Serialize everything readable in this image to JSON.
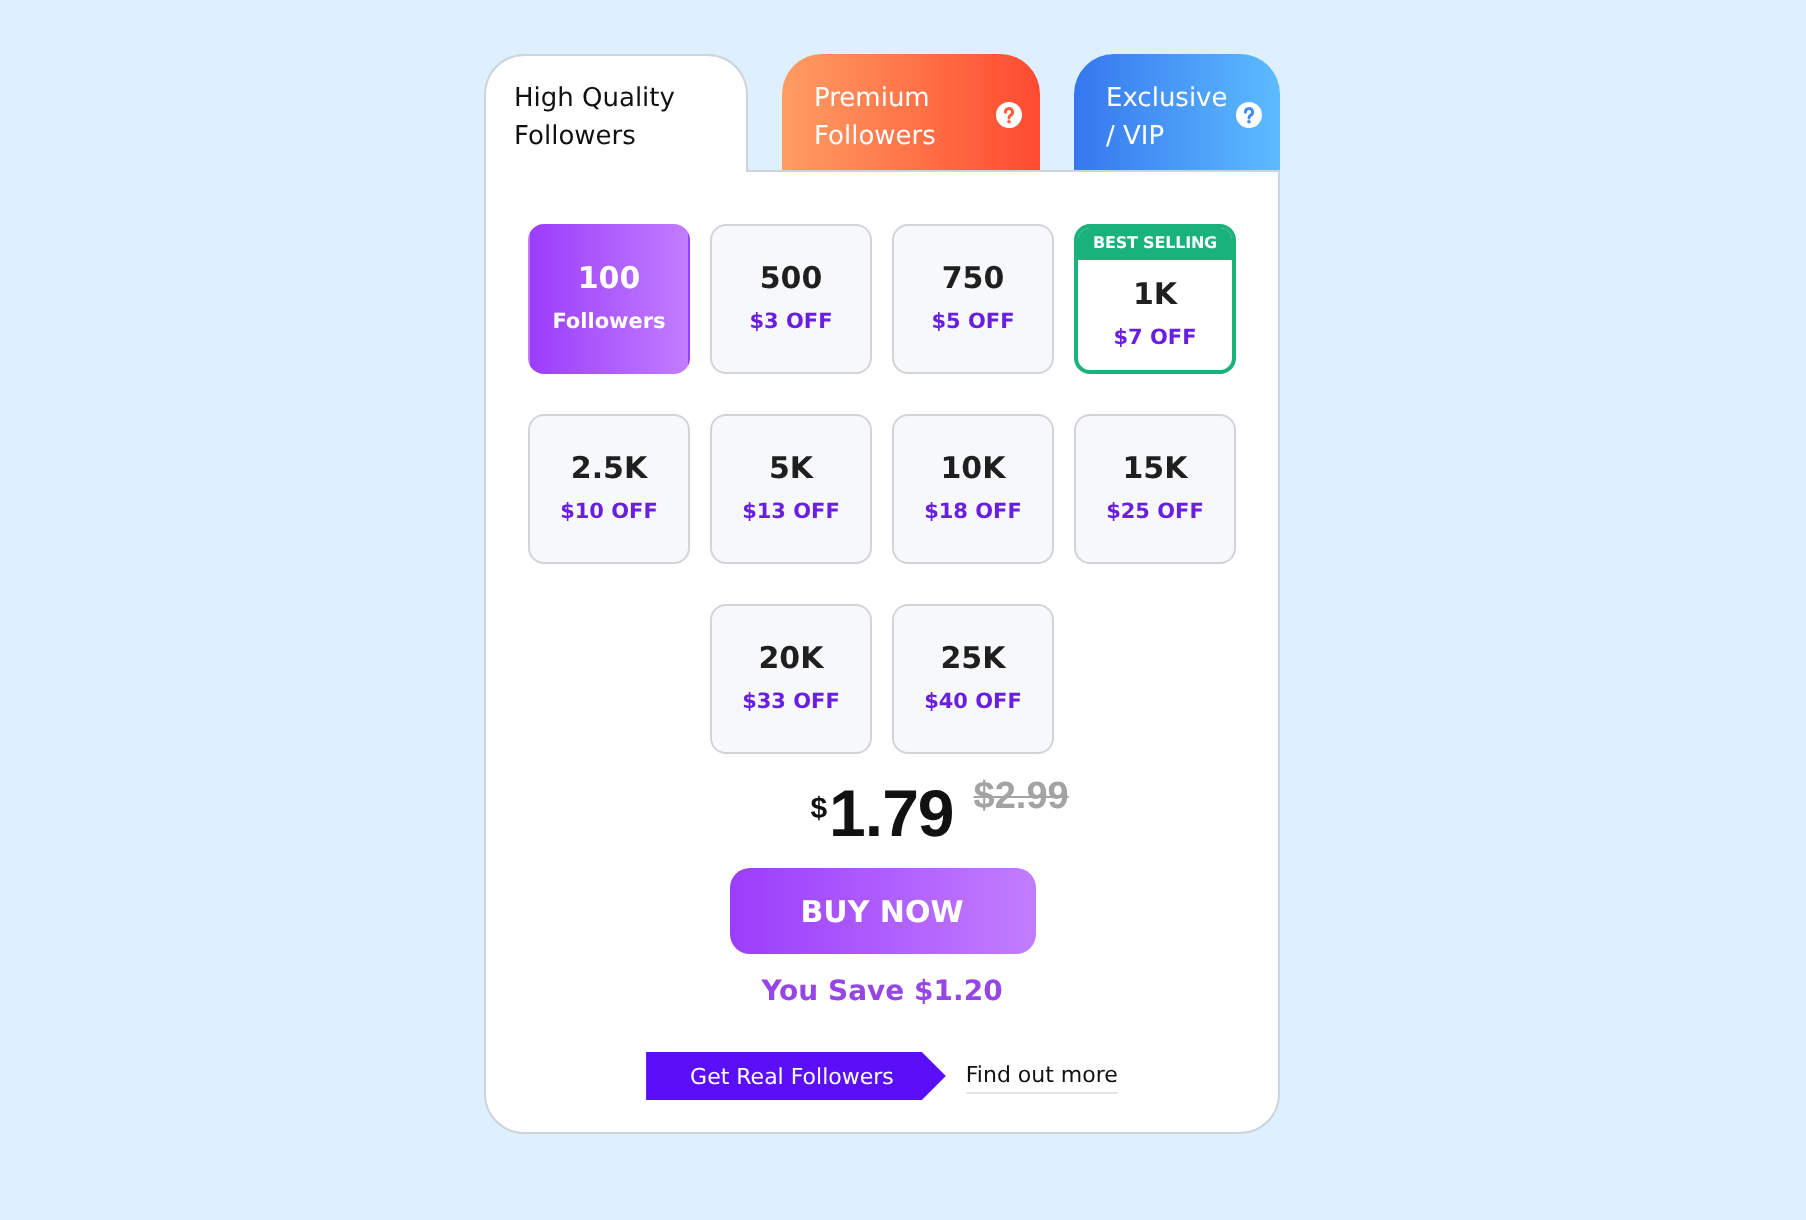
{
  "tabs": [
    {
      "label": "High Quality Followers",
      "kind": "standard",
      "selected": true,
      "help_icon": false
    },
    {
      "label": "Premium Followers",
      "kind": "premium",
      "selected": false,
      "help_icon": true
    },
    {
      "label": "Exclusive / VIP",
      "kind": "vip",
      "selected": false,
      "help_icon": true
    }
  ],
  "packages": [
    {
      "quantity": "100",
      "detail": "Followers",
      "selected": true
    },
    {
      "quantity": "500",
      "detail": "$3 OFF",
      "selected": false
    },
    {
      "quantity": "750",
      "detail": "$5 OFF",
      "selected": false
    },
    {
      "quantity": "1K",
      "detail": "$7 OFF",
      "selected": false,
      "badge": "BEST SELLING"
    },
    {
      "quantity": "2.5K",
      "detail": "$10 OFF",
      "selected": false
    },
    {
      "quantity": "5K",
      "detail": "$13 OFF",
      "selected": false
    },
    {
      "quantity": "10K",
      "detail": "$18 OFF",
      "selected": false
    },
    {
      "quantity": "15K",
      "detail": "$25 OFF",
      "selected": false
    },
    {
      "quantity": "20K",
      "detail": "$33 OFF",
      "selected": false
    },
    {
      "quantity": "25K",
      "detail": "$40 OFF",
      "selected": false
    }
  ],
  "price": {
    "currency": "$",
    "amount": "1.79",
    "original": "$2.99"
  },
  "buy_button": "BUY NOW",
  "savings": "You Save $1.20",
  "footer": {
    "ribbon": "Get Real Followers",
    "link": "Find out more"
  }
}
